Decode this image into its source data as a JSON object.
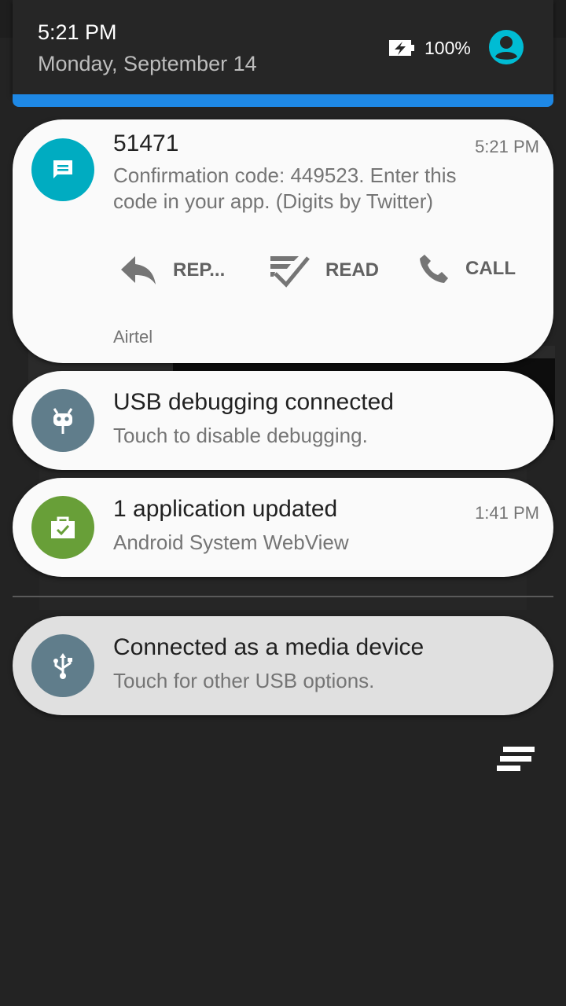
{
  "header": {
    "time": "5:21 PM",
    "date": "Monday, September 14",
    "battery_percent": "100%",
    "battery_icon": "battery-charging-icon",
    "user_icon": "account-circle-icon"
  },
  "notifications": [
    {
      "title": "51471",
      "time": "5:21 PM",
      "text_line1": "Confirmation code:  449523. Enter this",
      "text_line2": "code in your app. (Digits by Twitter)",
      "icon": "message-icon",
      "icon_color": "#00acc1",
      "actions": [
        {
          "label": "REP...",
          "icon": "reply-icon"
        },
        {
          "label": "READ",
          "icon": "mark-read-icon"
        },
        {
          "label": "CALL",
          "icon": "phone-icon"
        }
      ],
      "footer": "Airtel"
    },
    {
      "title": "USB debugging connected",
      "text": "Touch to disable debugging.",
      "icon": "android-debug-icon",
      "icon_color": "#607d8b"
    },
    {
      "title": "1 application updated",
      "time": "1:41 PM",
      "text": "Android System WebView",
      "icon": "shopping-bag-check-icon",
      "icon_color": "#689f38"
    },
    {
      "title": "Connected as a media device",
      "text": "Touch for other USB options.",
      "icon": "usb-icon",
      "icon_color": "#607d8b"
    }
  ],
  "clear_all_icon": "clear-all-icon",
  "accent_color": "#1e88e5"
}
